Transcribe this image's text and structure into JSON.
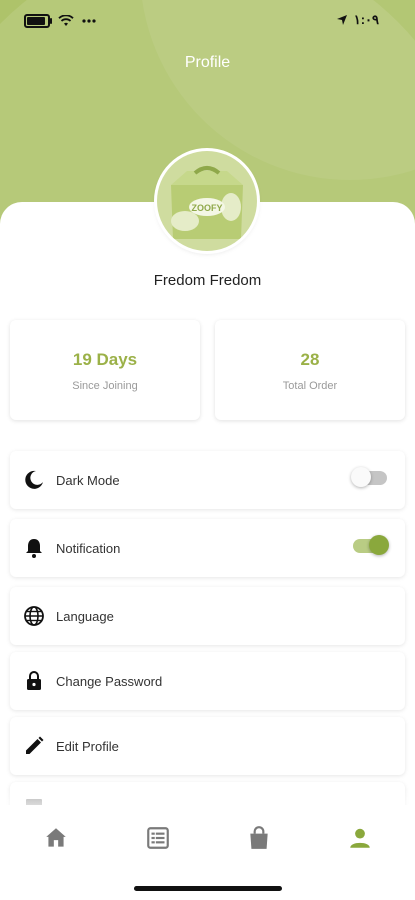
{
  "status_bar": {
    "time": "١:٠٩"
  },
  "header": {
    "title": "Profile"
  },
  "profile": {
    "name": "Fredom Fredom",
    "avatar_text": "ZOOFY"
  },
  "stats": [
    {
      "value": "19 Days",
      "label": "Since Joining"
    },
    {
      "value": "28",
      "label": "Total Order"
    }
  ],
  "settings": [
    {
      "label": "Dark Mode",
      "icon": "moon-icon",
      "toggle": false
    },
    {
      "label": "Notification",
      "icon": "bell-icon",
      "toggle": true
    },
    {
      "label": "Language",
      "icon": "globe-icon"
    },
    {
      "label": "Change Password",
      "icon": "lock-icon"
    },
    {
      "label": "Edit Profile",
      "icon": "pencil-icon"
    }
  ],
  "bottom_nav": [
    {
      "icon": "home-icon",
      "active": false
    },
    {
      "icon": "orders-list-icon",
      "active": false
    },
    {
      "icon": "shopping-bag-icon",
      "active": false
    },
    {
      "icon": "person-icon",
      "active": true
    }
  ],
  "colors": {
    "header": "#aec36a",
    "accent": "#9bb148",
    "inactive_icon": "#7a7a7a"
  }
}
